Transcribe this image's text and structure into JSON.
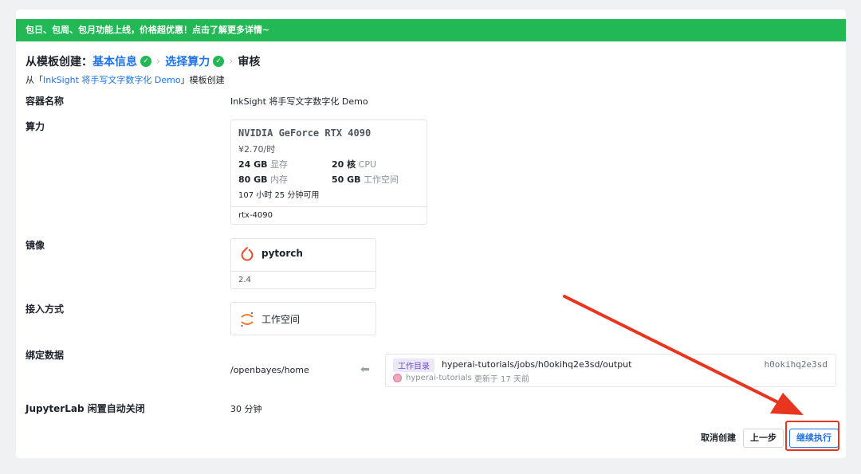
{
  "banner": {
    "text": "包日、包周、包月功能上线，价格超优惠！点击了解更多详情~"
  },
  "steps": {
    "lead": "从模板创建：",
    "step1": "基本信息",
    "step2": "选择算力",
    "step3": "审核"
  },
  "from": {
    "prefix": "从「",
    "template_link": "InkSight 将手写文字数字化 Demo",
    "suffix": "」模板创建"
  },
  "fields": {
    "container_name": {
      "label": "容器名称",
      "value": "InkSight 将手写文字数字化 Demo"
    },
    "compute": {
      "label": "算力",
      "gpu_name": "NVIDIA GeForce RTX 4090",
      "price": "¥2.70/时",
      "vram_value": "24 GB",
      "vram_unit": "显存",
      "cpu_value": "20 核",
      "cpu_unit": "CPU",
      "ram_value": "80 GB",
      "ram_unit": "内存",
      "disk_value": "50 GB",
      "disk_unit": "工作空间",
      "hours": "107 小时 25 分钟可用",
      "gpu_id": "rtx-4090"
    },
    "image": {
      "label": "镜像",
      "name": "pytorch",
      "version": "2.4",
      "icon": "pytorch-icon"
    },
    "access": {
      "label": "接入方式",
      "name": "工作空间",
      "icon": "jupyter-icon"
    },
    "binding": {
      "label": "绑定数据",
      "mount": "/openbayes/home",
      "tag": "工作目录",
      "path": "hyperai-tutorials/jobs/h0okihq2e3sd/output",
      "hash": "h0okihq2e3sd",
      "owner": "hyperai-tutorials",
      "updated": "更新于 17 天前"
    },
    "idle": {
      "label": "JupyterLab 闲置自动关闭",
      "value": "30 分钟"
    }
  },
  "buttons": {
    "cancel": "取消创建",
    "prev": "上一步",
    "next": "继续执行"
  },
  "colors": {
    "banner": "#22b855",
    "link": "#1f73e6",
    "highlight": "#e8351f"
  }
}
